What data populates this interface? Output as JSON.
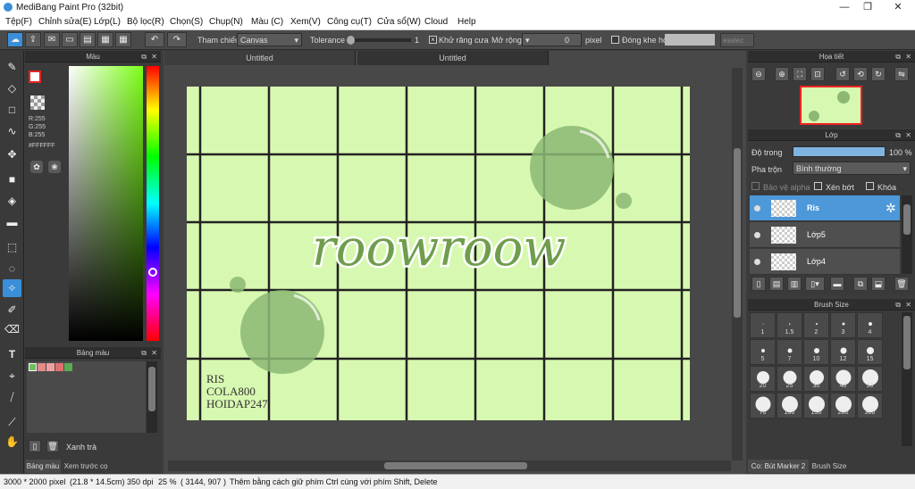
{
  "window": {
    "title": "MediBang Paint Pro (32bit)"
  },
  "menu": [
    "Tệp(F)",
    "Chỉnh sửa(E)",
    "Lớp(L)",
    "Bộ lọc(R)",
    "Chọn(S)",
    "Chụp(N)",
    "Màu (C)",
    "Xem(V)",
    "Công cụ(T)",
    "Cửa sổ(W)",
    "Cloud",
    "Help"
  ],
  "toolbar": {
    "reference_label": "Tham chiếu",
    "reference_value": "Canvas",
    "tolerance_label": "Tolerance",
    "tolerance_value": "1",
    "antialias_label": "Khử răng cưa",
    "expand_label": "Mở rộng",
    "expand_value": "0",
    "expand_unit": "pixel",
    "gap_label": "Đóng khe hở",
    "deselect_label": "eselec"
  },
  "color_panel": {
    "title": "Màu",
    "r": "R:255",
    "g": "G:255",
    "b": "B:255",
    "hex": "#FFFFFF"
  },
  "palette_panel": {
    "title": "Bảng màu",
    "palette_name": "Xanh trà",
    "swatches": [
      "#6fbf5a",
      "#e38a8a",
      "#f0a0a0",
      "#e07070",
      "#5aaa55"
    ],
    "tab_palette": "Bảng màu",
    "tab_preview": "Xem trước cọ"
  },
  "tabs": [
    "Untitled",
    "Untitled"
  ],
  "artwork": {
    "title_text": "roowroow",
    "credits": [
      "RIS",
      "COLA800",
      "HOIDAP247"
    ]
  },
  "navigator": {
    "title": "Họa tiết"
  },
  "layers": {
    "title": "Lớp",
    "opacity_label": "Độ trong",
    "opacity_value": "100 %",
    "blend_label": "Pha trộn",
    "blend_value": "Bình thường",
    "protect_alpha": "Bảo vệ alpha",
    "clip": "Xén bớt",
    "lock": "Khóa",
    "items": [
      {
        "name": "Ris",
        "active": true
      },
      {
        "name": "Lớp5",
        "active": false
      },
      {
        "name": "Lớp4",
        "active": false
      }
    ]
  },
  "brush_size": {
    "title": "Brush Size",
    "sizes": [
      "1",
      "1.5",
      "2",
      "3",
      "4",
      "5",
      "7",
      "10",
      "12",
      "15",
      "20",
      "25",
      "30",
      "40",
      "50",
      "70",
      "100",
      "150",
      "200",
      "300"
    ],
    "tab_color": "Co: Bút Marker 2",
    "tab_brush": "Brush Size"
  },
  "status": {
    "dimensions": "3000 * 2000 pixel",
    "physical": "(21.8 * 14.5cm)",
    "dpi": "350 dpi",
    "zoom": "25 %",
    "coords": "( 3144, 907 )",
    "hint": "Thêm bằng cách giữ phím Ctrl cùng với phím Shift, Delete"
  }
}
